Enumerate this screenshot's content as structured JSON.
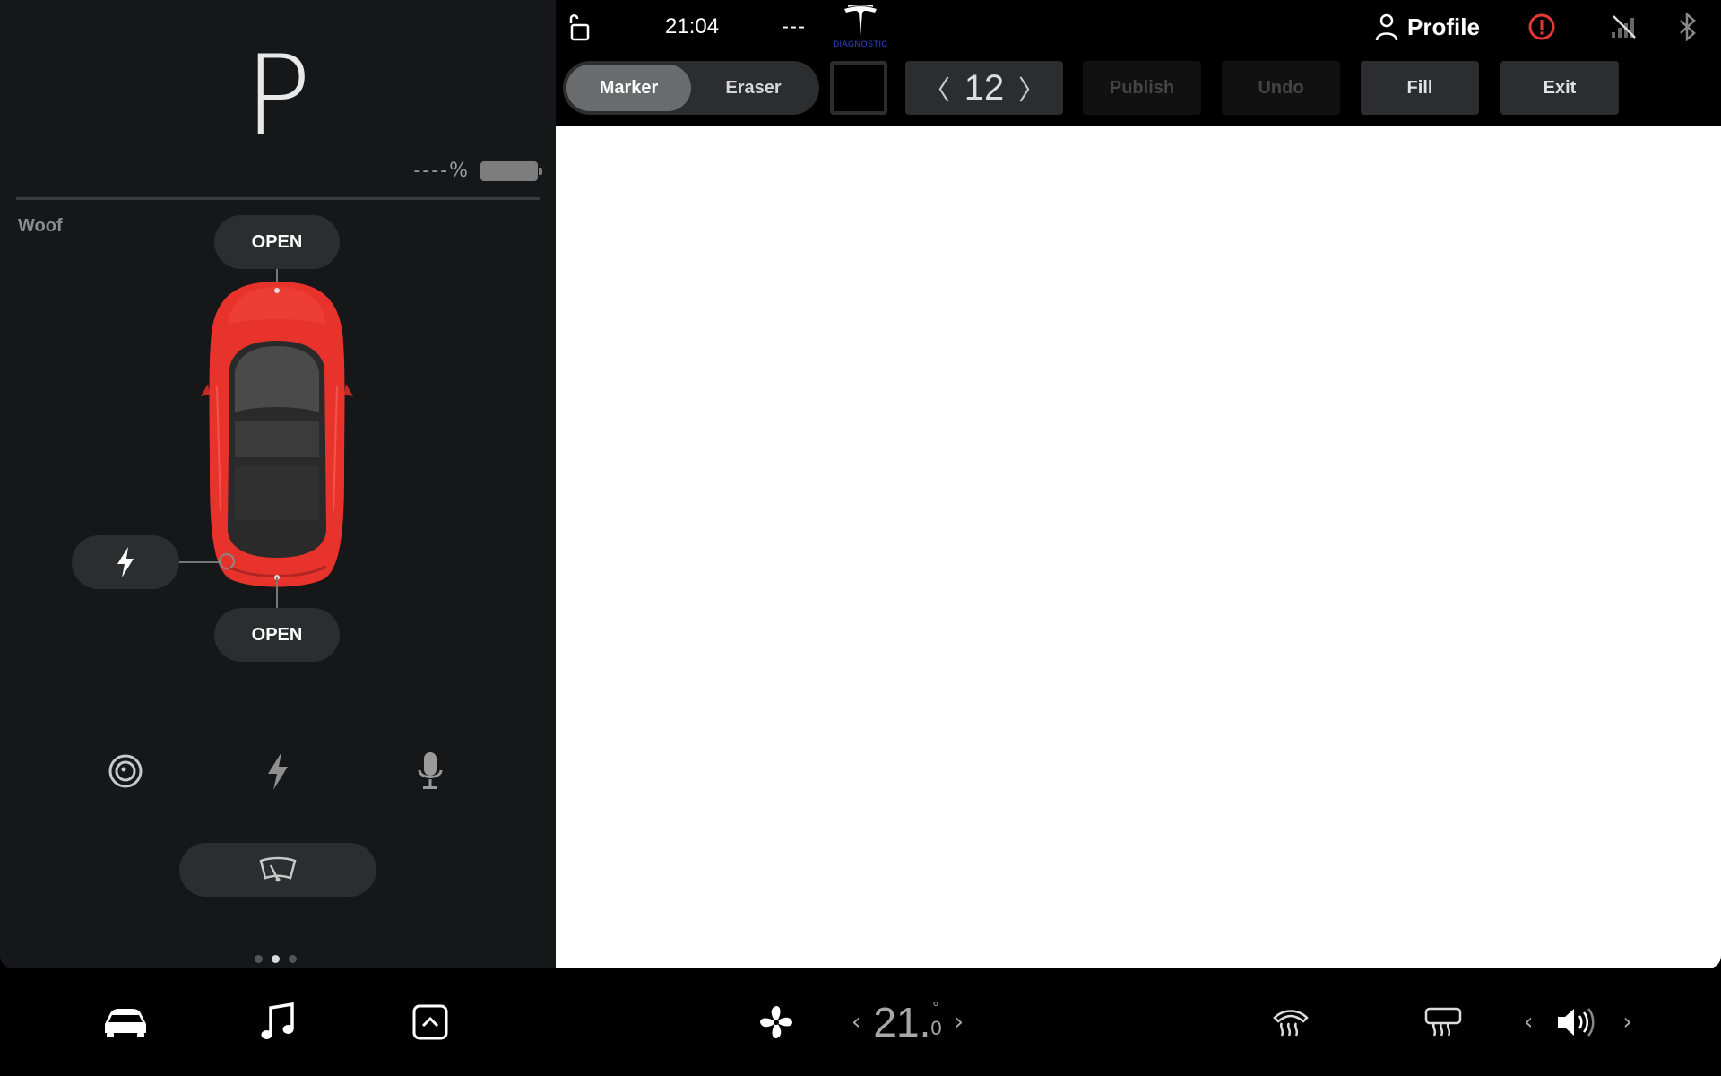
{
  "left_panel": {
    "gear": "P",
    "battery_percent": "----%",
    "car_name": "Woof",
    "frunk_label": "OPEN",
    "trunk_label": "OPEN",
    "page_dots": {
      "count": 3,
      "active_index": 1
    }
  },
  "status_bar": {
    "time": "21:04",
    "outside_temp": "---",
    "diagnostic_label": "DIAGNOSTIC",
    "profile_label": "Profile"
  },
  "toolbar": {
    "marker_label": "Marker",
    "eraser_label": "Eraser",
    "active_tool": "Marker",
    "selected_color": "#000000",
    "brush_size": "12",
    "publish_label": "Publish",
    "undo_label": "Undo",
    "fill_label": "Fill",
    "exit_label": "Exit"
  },
  "climate": {
    "set_temp_whole": "21.",
    "set_temp_decimal": "0",
    "degree_symbol": "°"
  },
  "colors": {
    "panel_bg": "#161718",
    "button_bg": "#2c2d2f",
    "car_red": "#e8332c",
    "alert_red": "#e53935",
    "diagnostic_blue": "#2b4bd8"
  },
  "icons": {
    "status_bar": [
      "lock-icon",
      "tesla-logo",
      "person-icon",
      "alert-icon",
      "no-signal-icon",
      "bluetooth-icon"
    ],
    "left_panel": [
      "charge-port-icon",
      "dashcam-icon",
      "power-icon",
      "microphone-icon",
      "wiper-icon"
    ],
    "bottom_bar": [
      "car-icon",
      "music-note-icon",
      "apps-launcher-icon",
      "fan-icon",
      "front-defrost-icon",
      "rear-defrost-icon",
      "volume-icon"
    ]
  }
}
